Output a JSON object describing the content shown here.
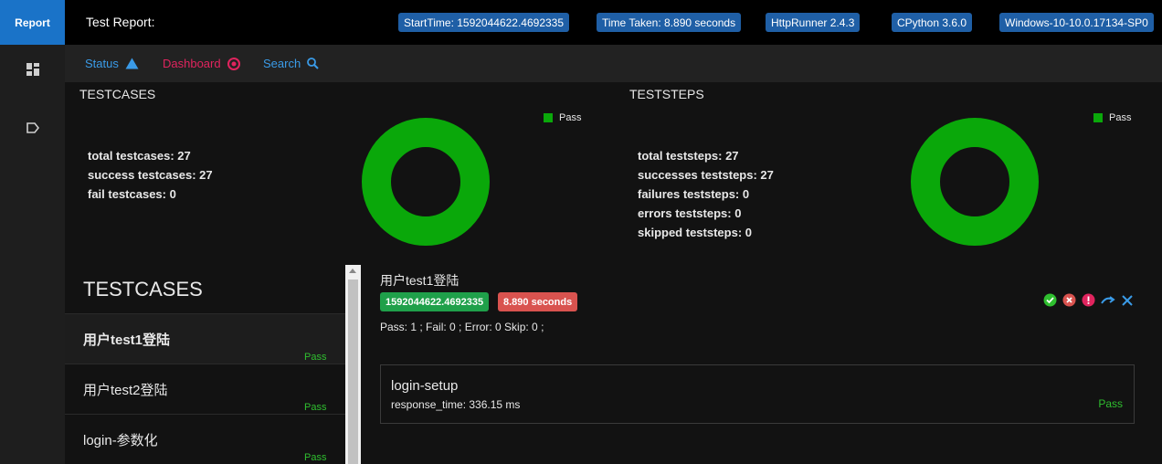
{
  "rail": {
    "report_label": "Report",
    "icons": [
      "dashboard-grid-icon",
      "tag-icon"
    ]
  },
  "topbar": {
    "title": "Test Report:",
    "chips": [
      "StartTime: 1592044622.4692335",
      "Time Taken: 8.890 seconds",
      "HttpRunner  2.4.3",
      "CPython 3.6.0",
      "Windows-10-10.0.17134-SP0"
    ]
  },
  "nav": {
    "status": "Status",
    "dashboard": "Dashboard",
    "search": "Search"
  },
  "testcases_stats": {
    "title": "TESTCASES",
    "lines": [
      "total testcases: 27",
      "success testcases: 27",
      "fail testcases: 0"
    ],
    "legend": "Pass",
    "pass_fraction": 1.0
  },
  "teststeps_stats": {
    "title": "TESTSTEPS",
    "lines": [
      "total teststeps: 27",
      "successes teststeps: 27",
      "failures teststeps: 0",
      "errors teststeps: 0",
      "skipped teststeps: 0"
    ],
    "legend": "Pass",
    "pass_fraction": 1.0
  },
  "testcase_list": {
    "heading": "TESTCASES",
    "items": [
      {
        "name": "用户test1登陆",
        "status": "Pass"
      },
      {
        "name": "用户test2登陆",
        "status": "Pass"
      },
      {
        "name": "login-参数化",
        "status": "Pass"
      }
    ]
  },
  "detail": {
    "title": "用户test1登陆",
    "start_badge": "1592044622.4692335",
    "duration_badge": "8.890 seconds",
    "summary": "Pass: 1 ; Fail: 0 ; Error: 0 Skip: 0 ;",
    "step": {
      "name": "login-setup",
      "meta": "response_time: 336.15 ms",
      "status": "Pass"
    }
  },
  "colors": {
    "accent": "#1a73c8",
    "pass": "#0aa80a",
    "fail": "#d9534f",
    "dashboard": "#e0245e"
  }
}
